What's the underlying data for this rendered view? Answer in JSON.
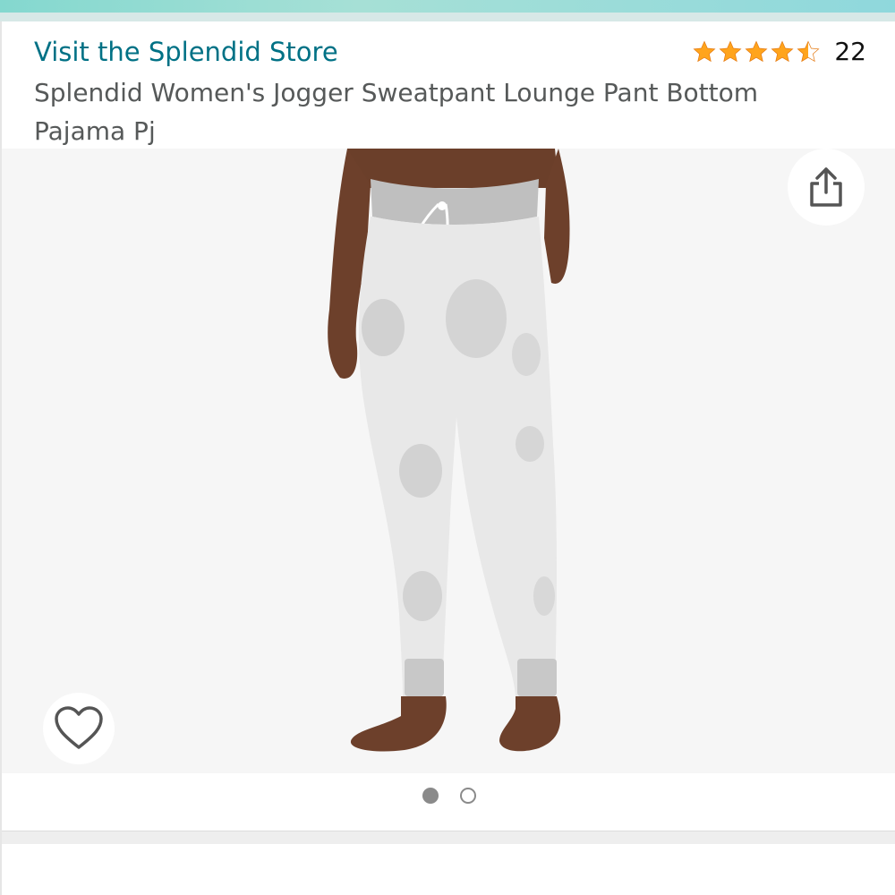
{
  "header": {
    "store_link": "Visit the Splendid Store",
    "product_title": "Splendid Women's Jogger Sweatpant Lounge Pant Bottom Pajama Pj",
    "rating_value": 4.5,
    "rating_count": "22"
  },
  "gallery": {
    "image_count": 2,
    "active_index": 0,
    "share_icon": "share-icon",
    "wish_icon": "heart-icon"
  },
  "colors": {
    "link": "#007185",
    "star": "#FFA41C",
    "title": "#565959"
  }
}
